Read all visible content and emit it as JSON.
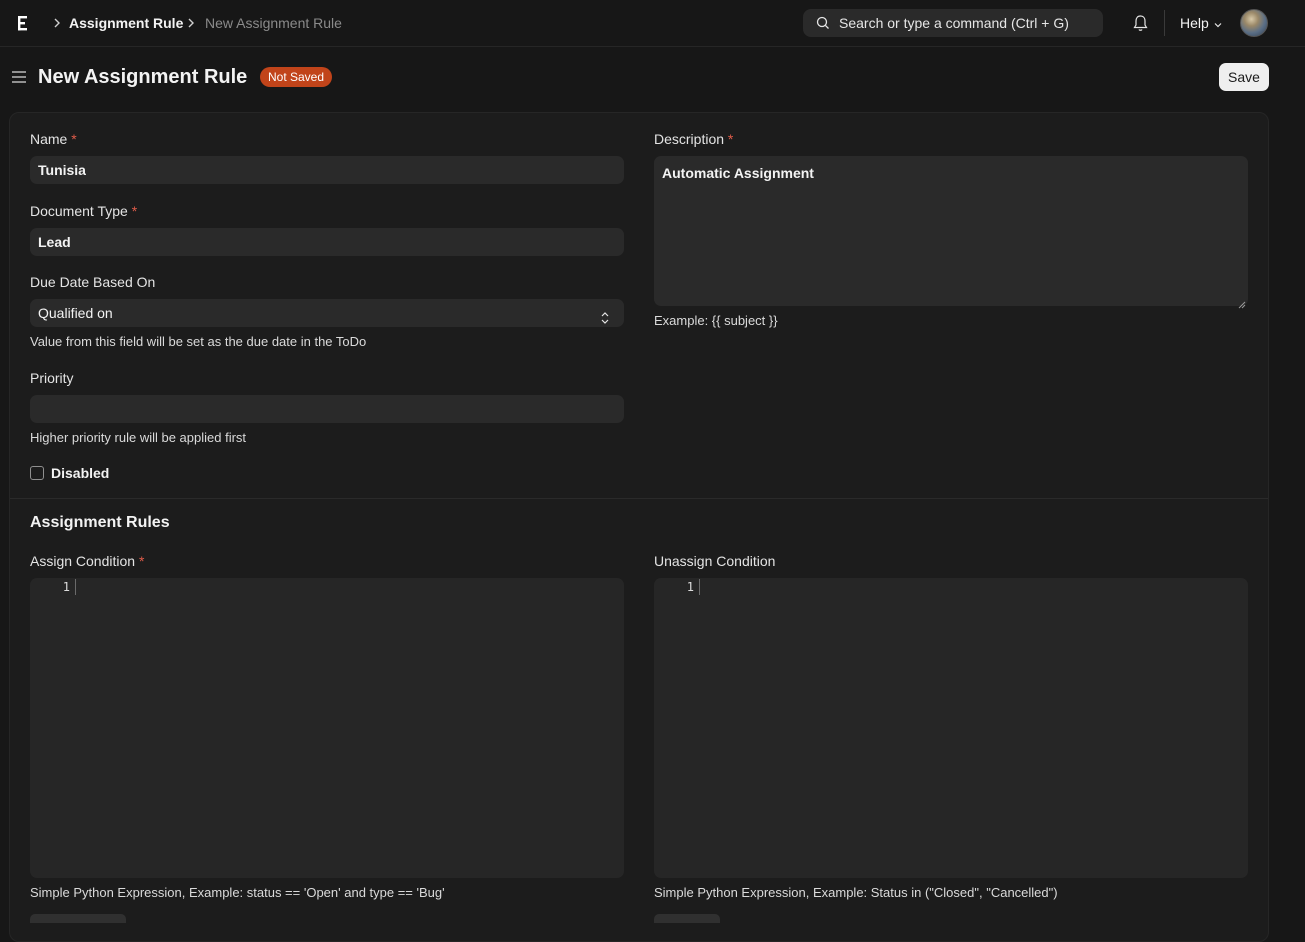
{
  "navbar": {
    "breadcrumbs": [
      "Assignment Rule",
      "New Assignment Rule"
    ],
    "search_placeholder": "Search or type a command (Ctrl + G)",
    "help_label": "Help"
  },
  "page": {
    "title": "New Assignment Rule",
    "status_badge": "Not Saved",
    "status_color": "#c1441a",
    "save_label": "Save"
  },
  "form": {
    "name": {
      "label": "Name",
      "value": "Tunisia"
    },
    "document_type": {
      "label": "Document Type",
      "value": "Lead"
    },
    "due_date_based_on": {
      "label": "Due Date Based On",
      "value": "Qualified on",
      "help": "Value from this field will be set as the due date in the ToDo"
    },
    "priority": {
      "label": "Priority",
      "value": "",
      "help": "Higher priority rule will be applied first"
    },
    "disabled": {
      "label": "Disabled",
      "checked": false
    },
    "description": {
      "label": "Description",
      "value": "Automatic Assignment",
      "help": "Example: {{ subject }}"
    }
  },
  "assignment_rules": {
    "title": "Assignment Rules",
    "assign_condition": {
      "label": "Assign Condition",
      "line_number": "1",
      "help": "Simple Python Expression, Example: status == 'Open' and type == 'Bug'"
    },
    "unassign_condition": {
      "label": "Unassign Condition",
      "line_number": "1",
      "help": "Simple Python Expression, Example: Status in (\"Closed\", \"Cancelled\")"
    }
  },
  "required_marker": "*"
}
